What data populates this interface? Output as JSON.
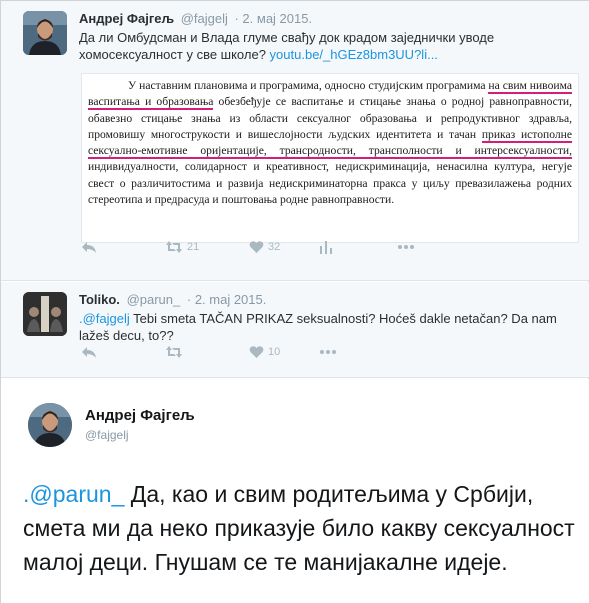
{
  "tweet1": {
    "name": "Андреј Фајгељ",
    "handle": "@fajgelj",
    "date": "· 2. мај 2015.",
    "text": "Да ли Омбудсман и Влада глуме свађу док крадом заједнички уводе хомосексуалност у све школе? ",
    "link": "youtu.be/_hGEz8bm3UU?li...",
    "doc": {
      "part1": "У наставним плановима и програмима, односно студијским програмима ",
      "underline1": "на свим нивоима васпитања и образовања",
      "part2": " обезбеђује се васпитање и стицање знања о родној равноправности, обавезно стицање знања из области сексуалног образовања и репродуктивног здравља, промовишу многострукости и вишеслојности људских идентитета и тачан ",
      "underline2": "приказ истополне сексуално-емотивне оријентације, трансродности, трансполности и интерсексуалности,",
      "part3": " индивидуалности, солидарност и креативност, недискриминација, ненасилна култура, негује свест о различитостима и развија недискриминаторна пракса у циљу превазилажења родних стереотипа и предрасуда и поштовања родне равноправности."
    },
    "retweets": "21",
    "likes": "32"
  },
  "tweet2": {
    "name": "Toliko.",
    "handle": "@parun_",
    "date": "· 2. maj 2015.",
    "mention": ".@fajgelj",
    "text": " Tebi smeta TAČAN PRIKAZ seksualnosti? Hoćeš dakle netačan? Da nam lažeš decu, to??",
    "likes": "10"
  },
  "tweet3": {
    "name": "Андреј Фајгељ",
    "handle": "@fajgelj",
    "mention": ".@parun_",
    "text": " Да, као и свим родитељима у Србији, смета ми да неко приказује било какву сексуалност малој деци. Гнушам се те манијакалне идеје."
  },
  "colors": {
    "link": "#1b95e0",
    "underline": "#d21f7a",
    "icon": "#aab8c2",
    "meta": "#8899a6"
  },
  "icons": [
    "reply-icon",
    "retweet-icon",
    "like-icon",
    "analytics-icon",
    "more-icon"
  ]
}
